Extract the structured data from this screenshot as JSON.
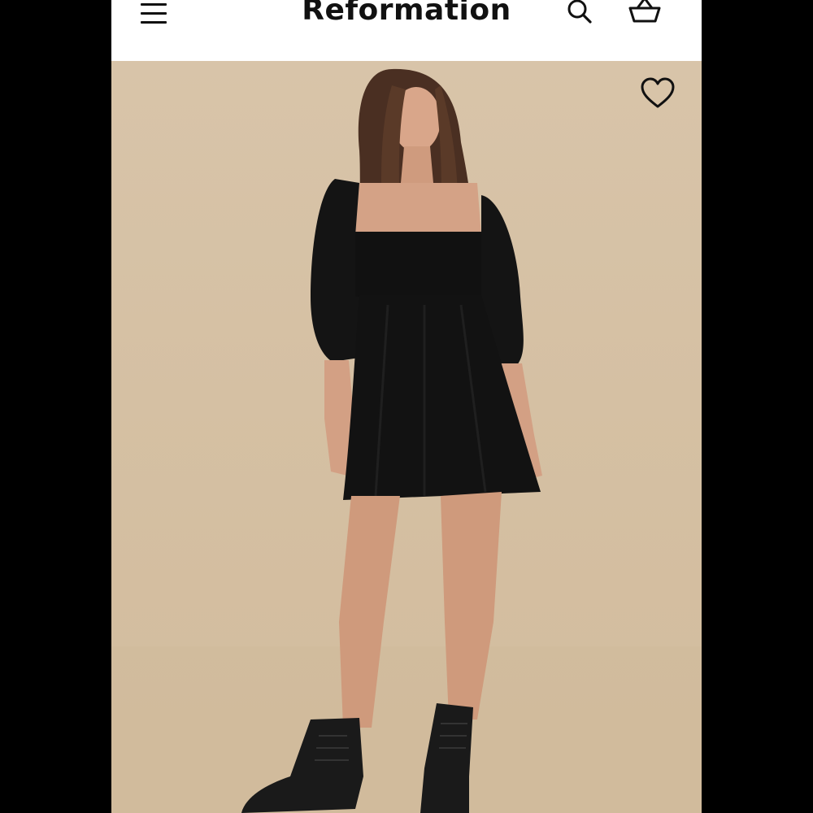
{
  "header": {
    "brand": "Reformation",
    "icons": {
      "menu": "menu-icon",
      "search": "search-icon",
      "cart": "shopping-basket-icon"
    }
  },
  "product_image": {
    "wishlist_icon": "heart-outline-icon",
    "background_color": "#d5c0a3",
    "dress_color": "#111111"
  }
}
